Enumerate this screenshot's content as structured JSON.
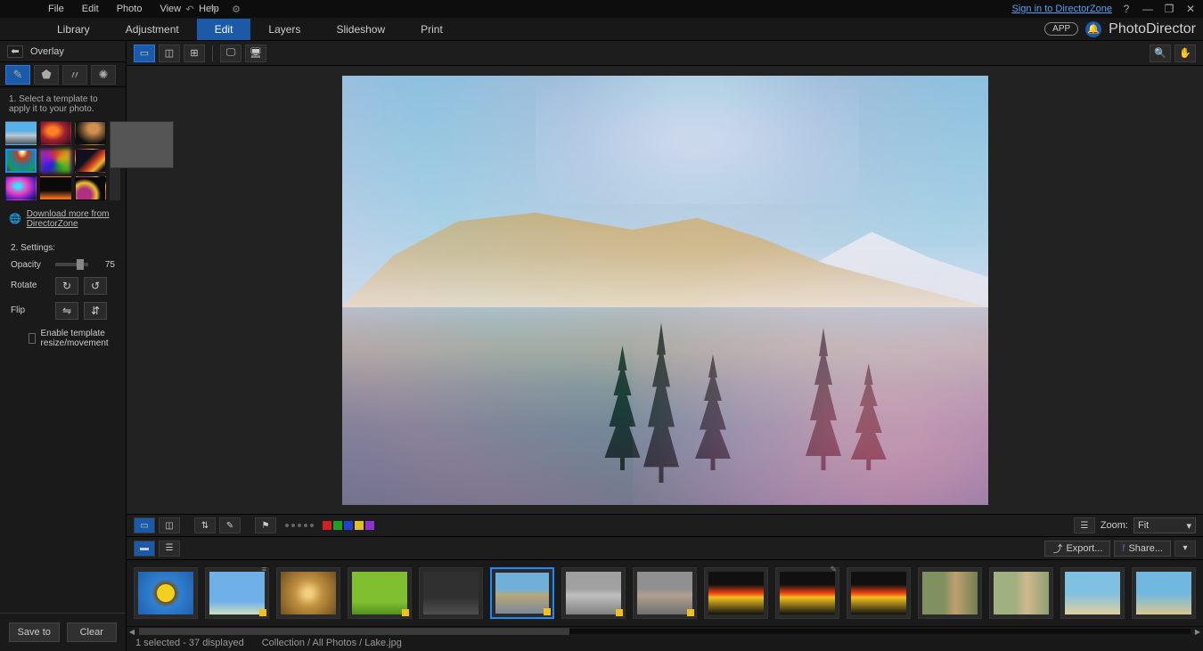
{
  "menu": {
    "items": [
      "File",
      "Edit",
      "Photo",
      "View",
      "Help"
    ],
    "signin": "Sign in to DirectorZone"
  },
  "modules": {
    "items": [
      "Library",
      "Adjustment",
      "Edit",
      "Layers",
      "Slideshow",
      "Print"
    ],
    "active": 2,
    "app": "APP",
    "brand": "PhotoDirector"
  },
  "sidebar": {
    "title": "Overlay",
    "instruction": "1. Select a template to apply it to your photo.",
    "download": "Download more from DirectorZone",
    "settings_label": "2. Settings:",
    "opacity_label": "Opacity",
    "opacity_value": "75",
    "rotate_label": "Rotate",
    "flip_label": "Flip",
    "enable_resize": "Enable template resize/movement",
    "save_to": "Save to",
    "clear": "Clear"
  },
  "lower": {
    "zoom_label": "Zoom:",
    "zoom_value": "Fit",
    "colors": [
      "#d02020",
      "#20a020",
      "#2040d0",
      "#e0c020",
      "#9030d0"
    ]
  },
  "strip": {
    "export": "Export...",
    "share": "Share..."
  },
  "status": {
    "selection": "1 selected - 37 displayed",
    "path": "Collection / All Photos / Lake.jpg"
  }
}
